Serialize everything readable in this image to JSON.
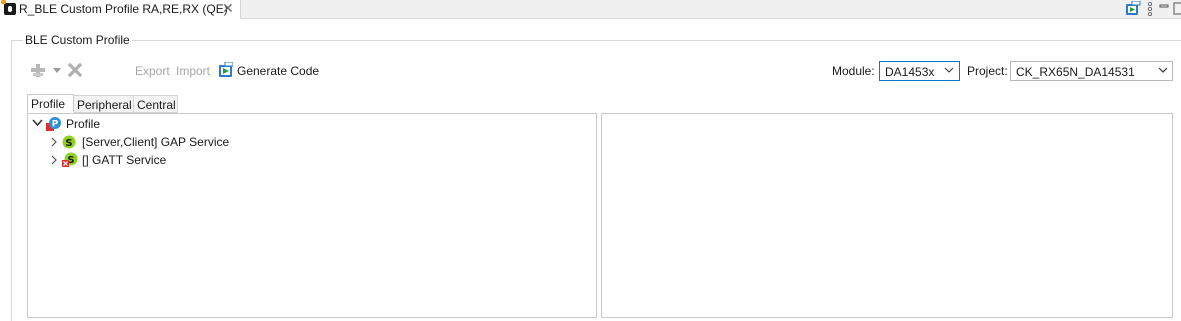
{
  "editor": {
    "tab_title": "R_BLE Custom Profile RA,RE,RX (QE)",
    "close_glyph": "✕"
  },
  "group": {
    "title": "BLE Custom Profile"
  },
  "toolbar": {
    "add_icon": "add-icon",
    "dropdown_icon": "triangle-down-icon",
    "delete_icon": "delete-icon",
    "export_label": "Export",
    "import_label": "Import",
    "generate_label": "Generate Code"
  },
  "module": {
    "label": "Module:",
    "value": "DA1453x"
  },
  "project": {
    "label": "Project:",
    "value": "CK_RX65N_DA14531"
  },
  "tabs": [
    {
      "label": "Profile",
      "selected": true
    },
    {
      "label": "Peripheral",
      "selected": false
    },
    {
      "label": "Central",
      "selected": false
    }
  ],
  "tree": {
    "root": {
      "label": "Profile",
      "icon": "profile-icon",
      "expanded": true
    },
    "children": [
      {
        "label": "[Server,Client] GAP Service",
        "icon": "service-icon",
        "expanded": false
      },
      {
        "label": "[] GATT Service",
        "icon": "service-error-icon",
        "expanded": false
      }
    ]
  },
  "colors": {
    "service_green": "#8ed122",
    "profile_blue": "#2f8fd8",
    "error_red": "#d9312b",
    "selection_border": "#0078d7"
  }
}
